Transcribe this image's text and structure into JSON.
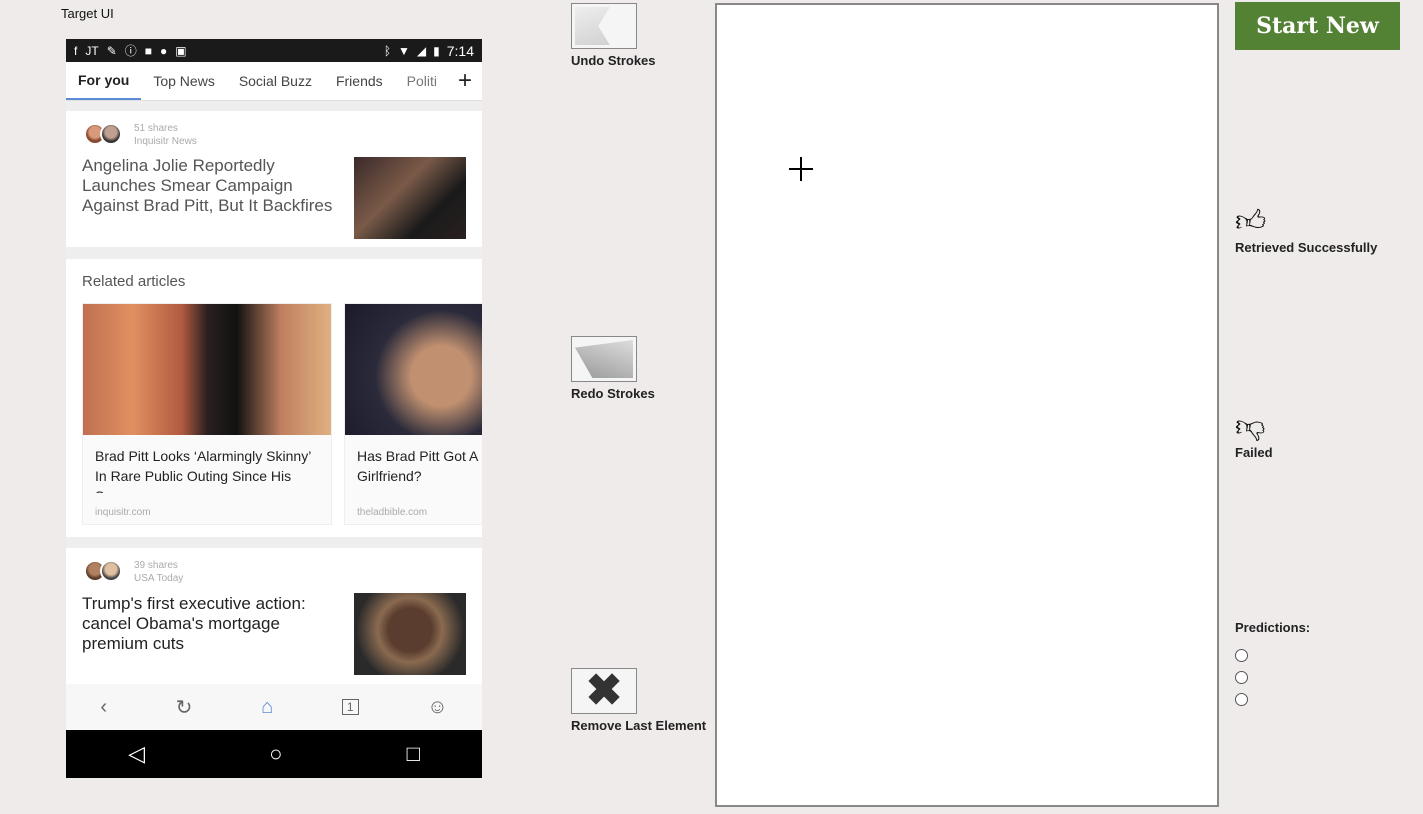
{
  "target_label": "Target UI",
  "phone": {
    "status_time": "7:14",
    "tabs": [
      "For you",
      "Top News",
      "Social Buzz",
      "Friends",
      "Politi"
    ],
    "card1": {
      "shares": "51 shares",
      "source": "Inquisitr News",
      "headline": "Angelina Jolie Reportedly Launches Smear Campaign Against Brad Pitt, But It Backfires"
    },
    "related": {
      "title": "Related articles",
      "items": [
        {
          "headline": "Brad Pitt Looks ‘Alarmingly Skinny’ In Rare Public Outing Since His Sp...",
          "source": "inquisitr.com"
        },
        {
          "headline": "Has Brad Pitt Got A Girlfriend?",
          "source": "theladbible.com"
        }
      ]
    },
    "card3": {
      "shares": "39 shares",
      "source": "USA Today",
      "headline": "Trump's first executive action: cancel Obama's mortgage premium cuts"
    },
    "nav": {
      "tab_count": "1"
    }
  },
  "tools": {
    "undo_label": "Undo Strokes",
    "redo_label": "Redo Strokes",
    "remove_label": "Remove Last Element"
  },
  "right_panel": {
    "start_label": "Start New",
    "success_label": "Retrieved Successfully",
    "failed_label": "Failed",
    "predictions_label": "Predictions:",
    "start_color": "#548235"
  }
}
